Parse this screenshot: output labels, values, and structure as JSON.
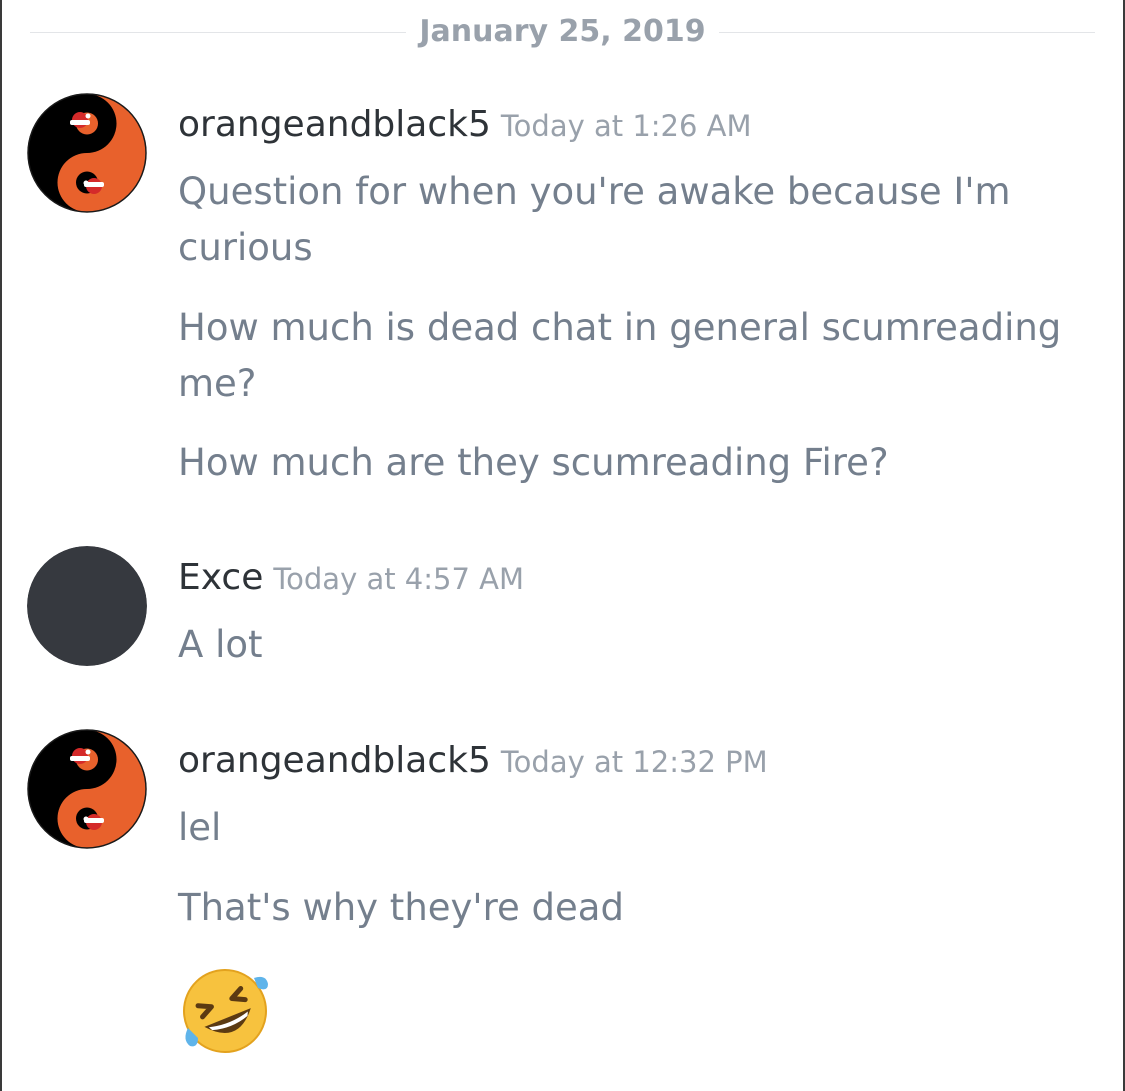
{
  "date_divider": "January 25, 2019",
  "messages": [
    {
      "username": "orangeandblack5",
      "timestamp": "Today at 1:26 AM",
      "avatar_icon": "yin-yang-santa-avatar",
      "lines": [
        "Question for when you're awake because I'm curious",
        "How much is dead chat in general scumreading me?",
        "How much are they scumreading Fire?"
      ]
    },
    {
      "username": "Exce",
      "timestamp": "Today at 4:57 AM",
      "avatar_icon": "default-dark-avatar",
      "lines": [
        "A lot"
      ]
    },
    {
      "username": "orangeandblack5",
      "timestamp": "Today at 12:32 PM",
      "avatar_icon": "yin-yang-santa-avatar",
      "lines": [
        "lel",
        "That's why they're dead"
      ],
      "emoji": "rolling-on-floor-laughing-emoji"
    }
  ],
  "colors": {
    "username": "#2e3338",
    "timestamp": "#99a1ab",
    "message_text": "#747f8d",
    "divider_line": "#e3e5e8",
    "avatar_orange": "#e8612c",
    "avatar_black": "#000000",
    "avatar_gray": "#36393f"
  }
}
